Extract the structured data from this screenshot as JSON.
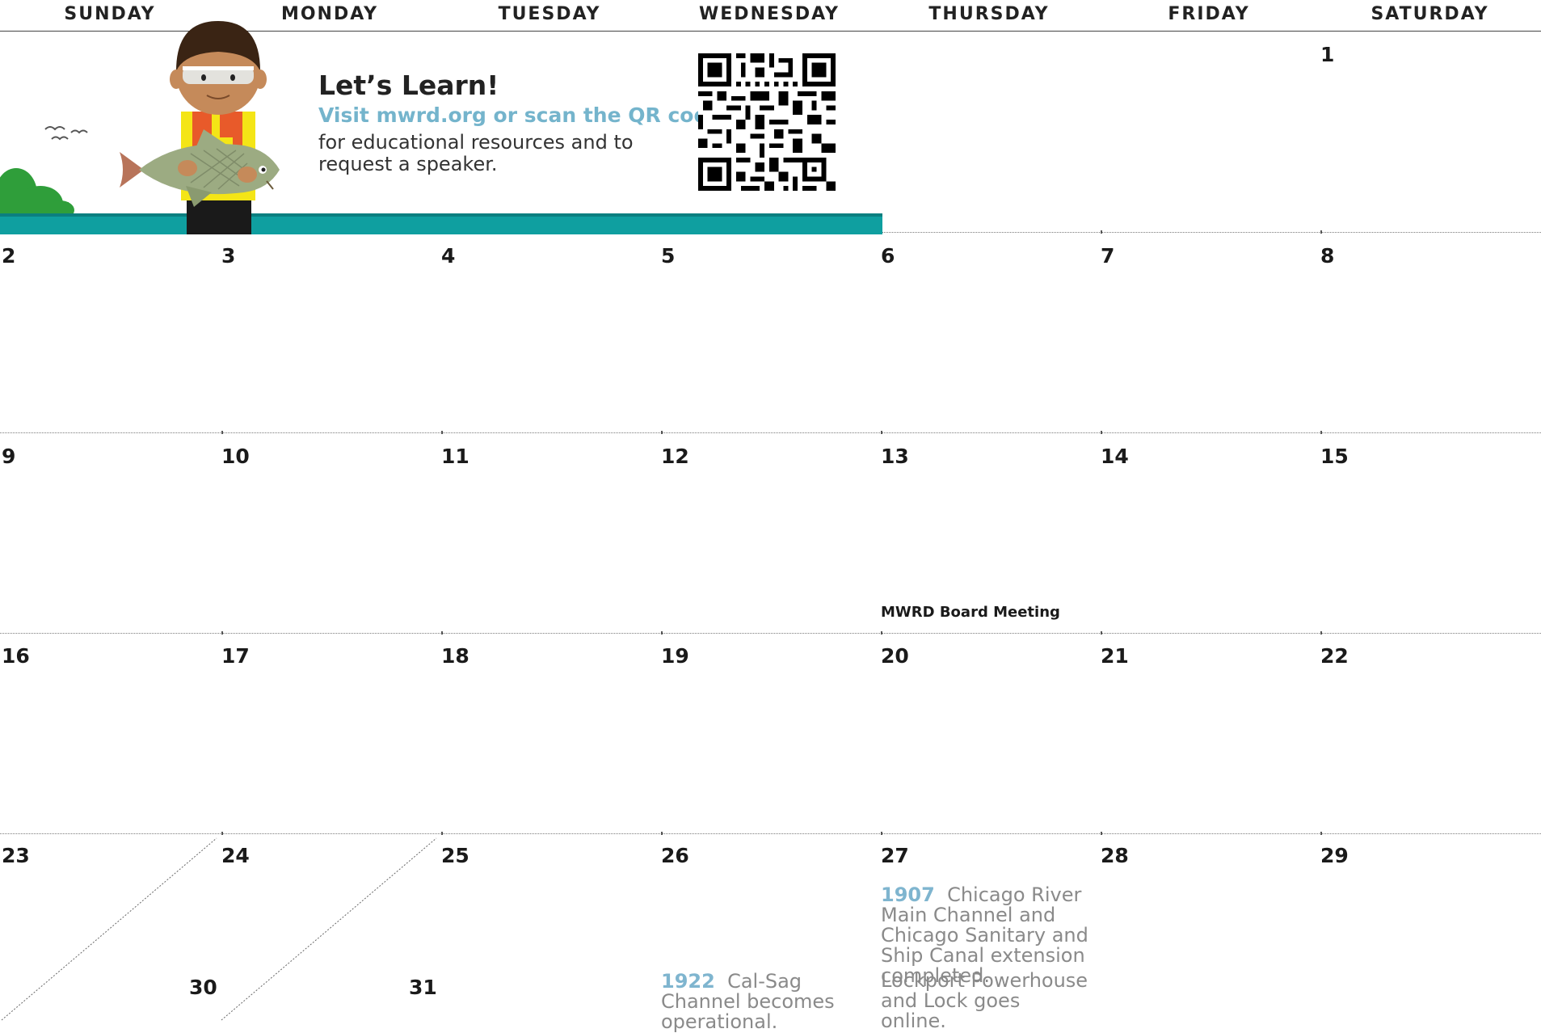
{
  "weekdays": [
    "SUNDAY",
    "MONDAY",
    "TUESDAY",
    "WEDNESDAY",
    "THURSDAY",
    "FRIDAY",
    "SATURDAY"
  ],
  "promo": {
    "title": "Let’s Learn!",
    "link_text": "Visit mwrd.org or scan the QR code",
    "body": "for educational resources and to request a speaker."
  },
  "days": {
    "d1": "1",
    "d2": "2",
    "d3": "3",
    "d4": "4",
    "d5": "5",
    "d6": "6",
    "d7": "7",
    "d8": "8",
    "d9": "9",
    "d10": "10",
    "d11": "11",
    "d12": "12",
    "d13": "13",
    "d14": "14",
    "d15": "15",
    "d16": "16",
    "d17": "17",
    "d18": "18",
    "d19": "19",
    "d20": "20",
    "d21": "21",
    "d22": "22",
    "d23": "23",
    "d24": "24",
    "d25": "25",
    "d26": "26",
    "d27": "27",
    "d28": "28",
    "d29": "29",
    "d30": "30",
    "d31": "31"
  },
  "events": {
    "board_meeting": "MWRD Board Meeting"
  },
  "history": {
    "cal_sag": {
      "year": "1922",
      "text": "Cal-Sag Channel becomes operational."
    },
    "main_channel": {
      "year": "1907",
      "text": "Chicago River Main Channel and Chicago Sanitary and Ship Canal extension completed."
    },
    "lockport": {
      "text": "Lockport Powerhouse and Lock goes online."
    }
  },
  "colors": {
    "teal_water": "#0f9fa0",
    "link_blue": "#74b4cc",
    "history_gray": "#8a8a8a"
  }
}
